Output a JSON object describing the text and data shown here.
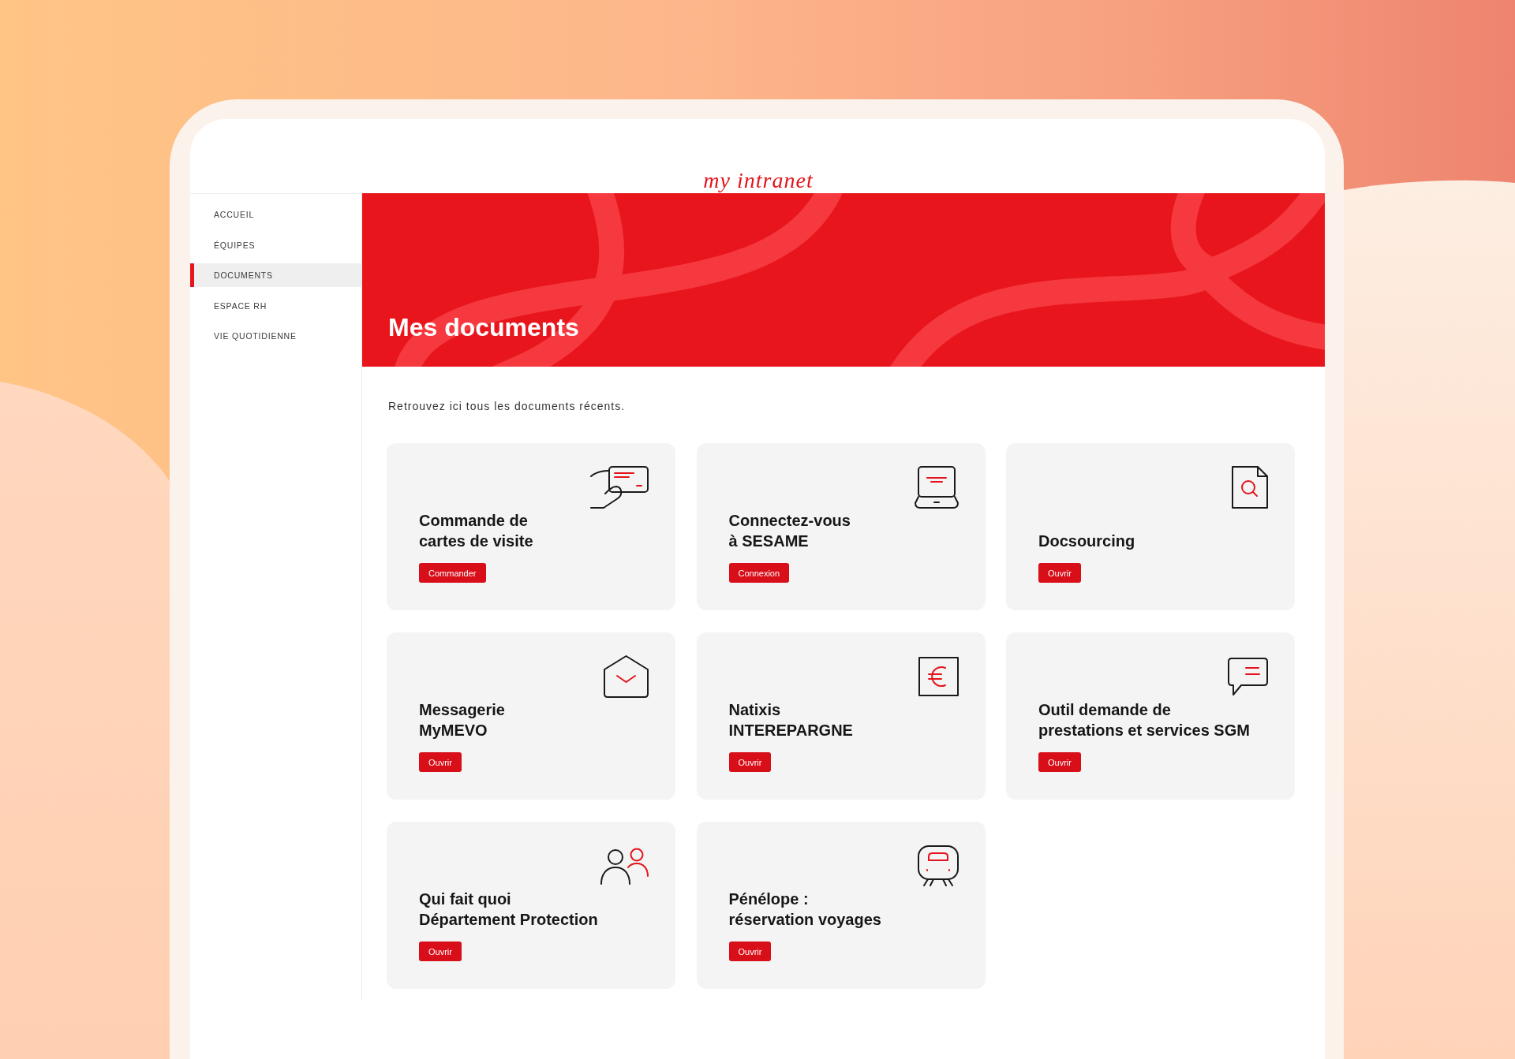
{
  "header": {
    "logo": "my intranet"
  },
  "sidebar": {
    "items": [
      {
        "label": "ACCUEIL",
        "selected": false
      },
      {
        "label": "ÉQUIPES",
        "selected": false
      },
      {
        "label": "DOCUMENTS",
        "selected": true
      },
      {
        "label": "ESPACE RH",
        "selected": false
      },
      {
        "label": "VIE QUOTIDIENNE",
        "selected": false
      }
    ]
  },
  "banner": {
    "title": "Mes documents"
  },
  "intro": "Retrouvez ici tous les documents récents.",
  "cards": [
    {
      "kind": "business-card",
      "title": "Commande de\ncartes de visite",
      "button": "Commander"
    },
    {
      "kind": "laptop",
      "title": "Connectez-vous\nà SESAME",
      "button": "Connexion"
    },
    {
      "kind": "document-search",
      "title": "Docsourcing",
      "button": "Ouvrir"
    },
    {
      "kind": "envelope",
      "title": "Messagerie\nMyMEVO",
      "button": "Ouvrir"
    },
    {
      "kind": "euro",
      "title": "Natixis\nINTEREPARGNE",
      "button": "Ouvrir"
    },
    {
      "kind": "chat",
      "title": "Outil demande de\nprestations et services SGM",
      "button": "Ouvrir"
    },
    {
      "kind": "people",
      "title": "Qui fait quoi\nDépartement Protection",
      "button": "Ouvrir"
    },
    {
      "kind": "train",
      "title": "Pénélope :\nréservation voyages",
      "button": "Ouvrir"
    }
  ]
}
